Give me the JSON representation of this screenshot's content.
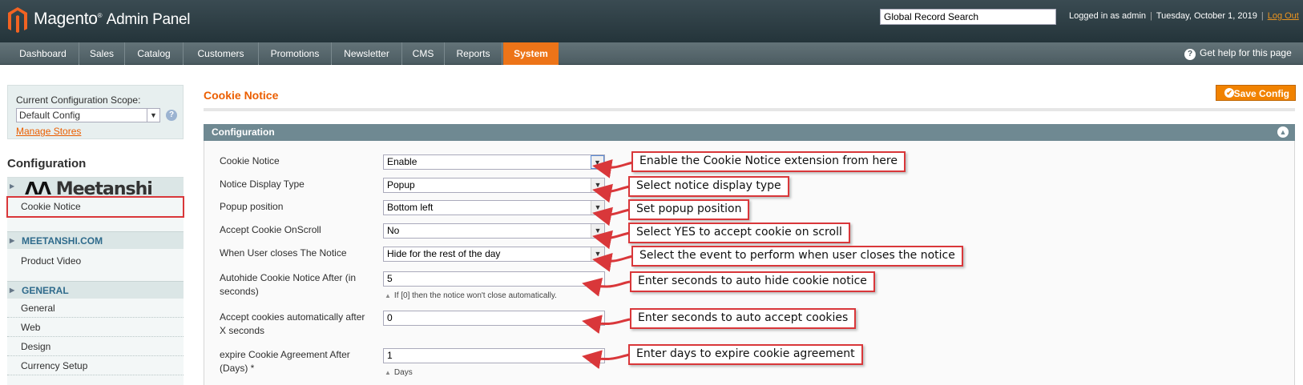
{
  "header": {
    "brand_main": "Magento",
    "brand_sub": "Admin Panel",
    "search_value": "Global Record Search",
    "logged_in": "Logged in as admin",
    "date": "Tuesday, October 1, 2019",
    "logout": "Log Out"
  },
  "nav": {
    "items": [
      "Dashboard",
      "Sales",
      "Catalog",
      "Customers",
      "Promotions",
      "Newsletter",
      "CMS",
      "Reports",
      "System"
    ],
    "active": "System",
    "help": "Get help for this page"
  },
  "sidebar": {
    "scope_label": "Current Configuration Scope:",
    "scope_value": "Default Config",
    "manage_stores": "Manage Stores",
    "config_title": "Configuration",
    "meetanshi_logo_text": "Meetanshi",
    "cookie_notice": "Cookie Notice",
    "group_meetanshi": "MEETANSHI.COM",
    "product_video": "Product Video",
    "group_general": "GENERAL",
    "general_items": [
      "General",
      "Web",
      "Design",
      "Currency Setup"
    ]
  },
  "main": {
    "title": "Cookie Notice",
    "save_button": "Save Config",
    "fieldset_title": "Configuration",
    "fields": [
      {
        "label": "Cookie Notice",
        "value": "Enable"
      },
      {
        "label": "Notice Display Type",
        "value": "Popup"
      },
      {
        "label": "Popup position",
        "value": "Bottom left"
      },
      {
        "label": "Accept Cookie OnScroll",
        "value": "No"
      },
      {
        "label": "When User closes The Notice",
        "value": "Hide for the rest of the day"
      },
      {
        "label": "Autohide Cookie Notice After (in seconds)",
        "value": "5",
        "note": "If [0] then the notice won't close automatically."
      },
      {
        "label": "Accept cookies automatically after X seconds",
        "value": "0"
      },
      {
        "label": "expire Cookie Agreement After (Days) *",
        "value": "1",
        "note": "Days"
      }
    ]
  },
  "callouts": [
    "Enable the Cookie Notice extension from here",
    "Select notice display type",
    "Set popup position",
    "Select YES to accept cookie on scroll",
    "Select the event to perform when user closes the notice",
    "Enter seconds to auto hide cookie notice",
    "Enter seconds to auto accept cookies",
    "Enter days to expire cookie agreement"
  ],
  "colors": {
    "accent": "#ed7418",
    "callout_border": "#d9373a",
    "fieldset_header": "#6f8992"
  }
}
